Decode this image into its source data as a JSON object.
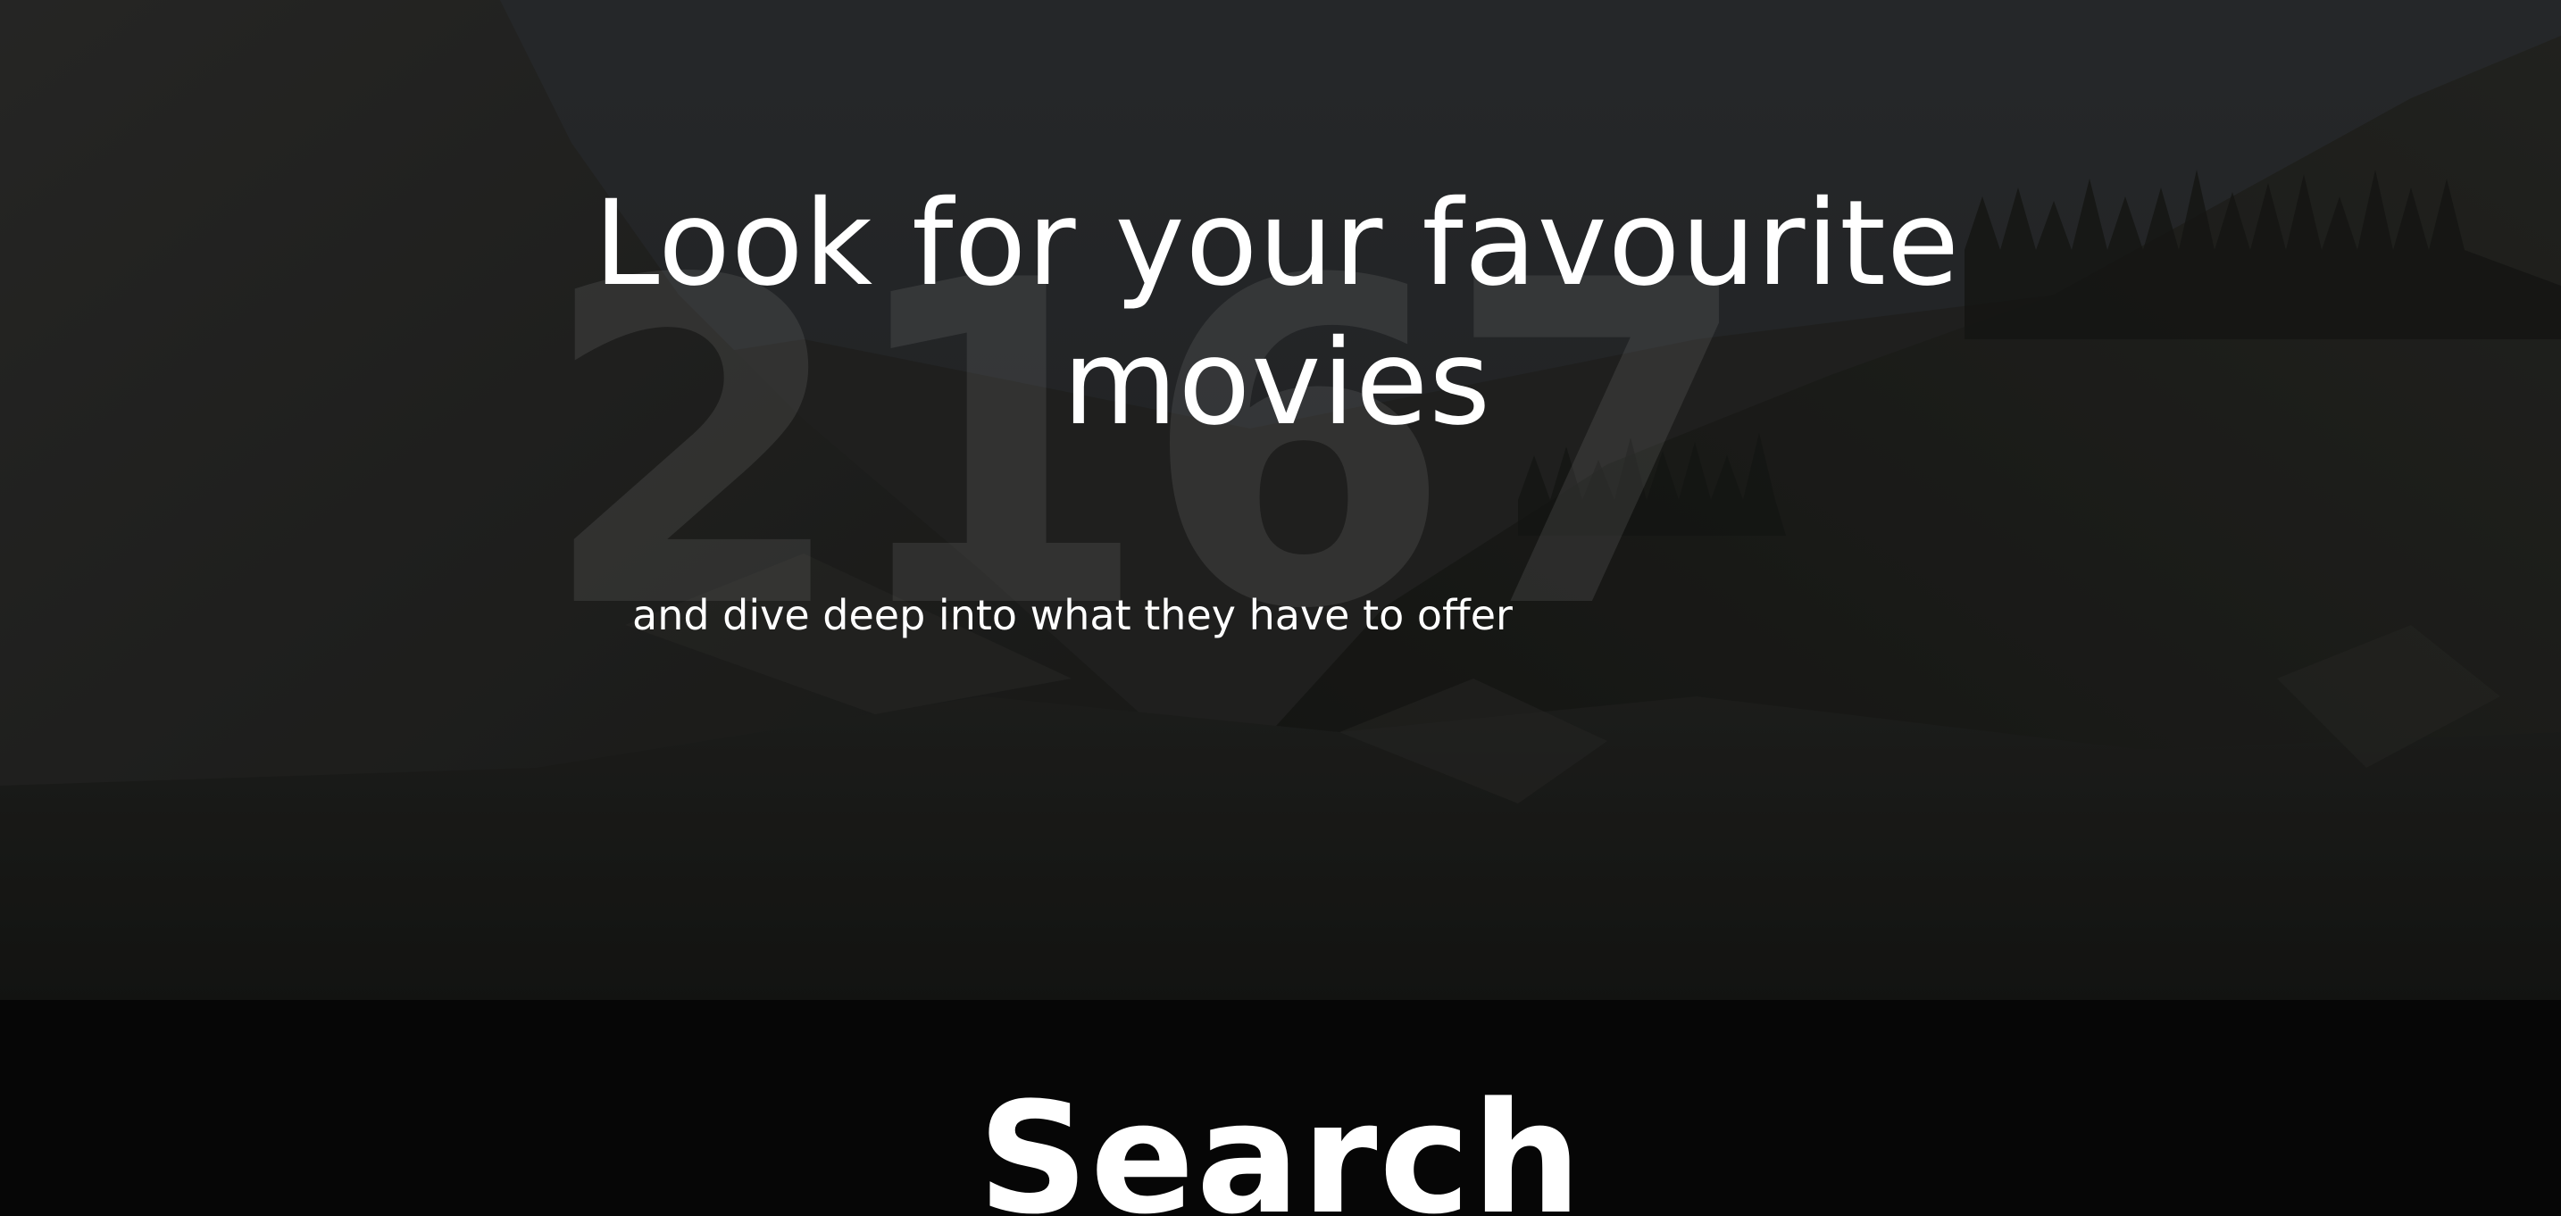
{
  "hero": {
    "background_image": "mountain-forest-background",
    "background_number": "2167",
    "title": "Look for your favourite movies",
    "subtitle": "and dive deep into what they have to offer"
  },
  "search_section": {
    "heading": "Search"
  },
  "colors": {
    "hero_text": "#ffffff",
    "search_background": "#060606",
    "background_number": "#8c8c8c"
  }
}
